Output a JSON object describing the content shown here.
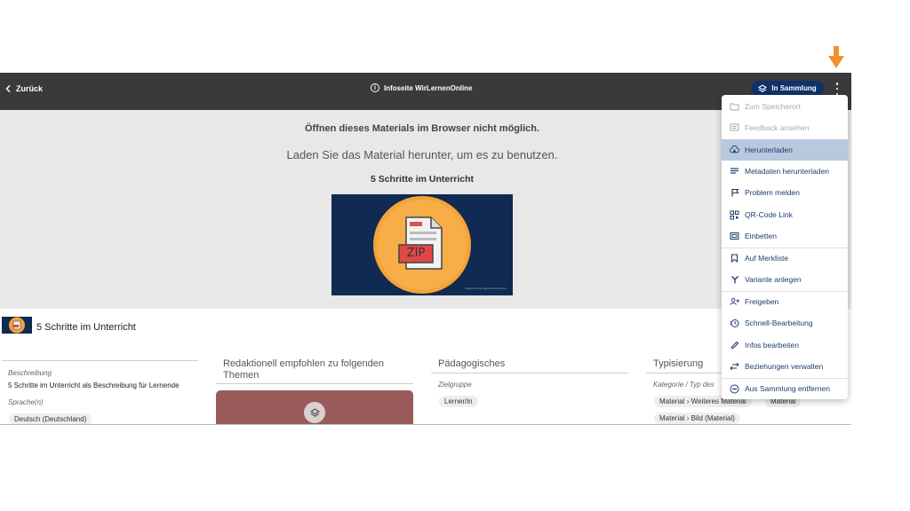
{
  "topbar": {
    "back_label": "Zurück",
    "info_label": "Infoseite WirLernenOnline",
    "collection_button_label": "In Sammlung"
  },
  "preview": {
    "line1": "Öffnen dieses Materials im Browser nicht möglich.",
    "line2": "Laden Sie das Material herunter, um es zu benutzen.",
    "line3": "5 Schritte im Unterricht",
    "thumb_text": "ZIP",
    "thumb_small_text": "Quelle/Lizenz/Lernobjekt/WirLernenOnline"
  },
  "material": {
    "title": "5 Schritte im Unterricht"
  },
  "columns": {
    "beschreibung_label": "Beschreibung",
    "beschreibung_value": "5 Schritte im Unterricht als Beschreibung für Lernende",
    "sprache_label": "Sprache(n)",
    "sprache_value": "Deutsch (Deutschland)",
    "redaktionell_head": "Redaktionell empfohlen zu folgenden Themen",
    "paedagogisches_head": "Pädagogisches",
    "zielgruppe_label": "Zielgruppe",
    "zielgruppe_value": "Lerner/in",
    "typisierung_head": "Typisierung",
    "kategorie_label": "Kategorie / Typ des",
    "kategorie_chip1": "Material",
    "kategorie_chip2": "Weiteres Material",
    "kategorie_chip3": "Material",
    "kategorie_chip4": "Material",
    "kategorie_chip5": "Bild (Material)",
    "separator": "›"
  },
  "menu": {
    "items": [
      {
        "label": "Zum Speicherort",
        "icon": "folder-icon"
      },
      {
        "label": "Feedback ansehen",
        "icon": "feedback-icon"
      },
      {
        "label": "Herunterladen",
        "icon": "cloud-download-icon"
      },
      {
        "label": "Metadaten herunterladen",
        "icon": "list-icon"
      },
      {
        "label": "Problem melden",
        "icon": "flag-icon"
      },
      {
        "label": "QR-Code Link",
        "icon": "qr-code-icon"
      },
      {
        "label": "Einbetten",
        "icon": "embed-icon"
      },
      {
        "label": "Auf Merkliste",
        "icon": "bookmark-icon"
      },
      {
        "label": "Variante anlegen",
        "icon": "fork-icon"
      },
      {
        "label": "Freigeben",
        "icon": "share-person-icon"
      },
      {
        "label": "Schnell-Bearbeitung",
        "icon": "quick-edit-icon"
      },
      {
        "label": "Infos bearbeiten",
        "icon": "pencil-icon"
      },
      {
        "label": "Beziehungen verwalten",
        "icon": "swap-icon"
      },
      {
        "label": "Aus Sammlung entfernen",
        "icon": "remove-circle-icon"
      }
    ]
  },
  "colors": {
    "topbar": "#3a3a3a",
    "collection_button": "#12306a",
    "menu_text": "#1f3b6e",
    "menu_highlight": "#b8c8dd",
    "arrow": "#f0922b",
    "thumb_bg": "#102a52",
    "thumb_circle": "#f5a23a",
    "redbox": "#9b5a5a"
  }
}
